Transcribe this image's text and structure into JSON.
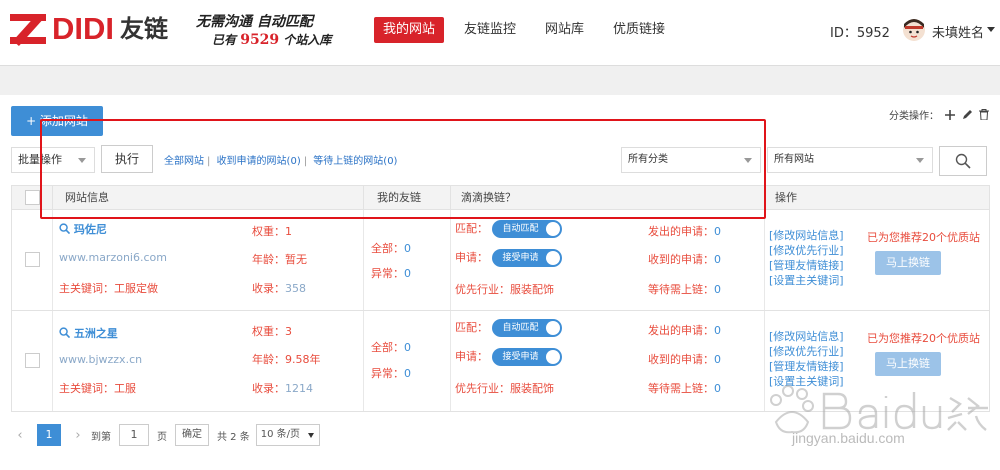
{
  "brand": {
    "logo_text": "DIDI",
    "logo_cn": "友链",
    "slogan_line1": "无需沟通 自动匹配",
    "slogan_prefix": "已有",
    "site_count": "9529",
    "slogan_suffix": "个站入库"
  },
  "nav": {
    "items": [
      "我的网站",
      "友链监控",
      "网站库",
      "优质链接"
    ],
    "active": 0
  },
  "user": {
    "id_label": "ID：5952",
    "name": "未填姓名"
  },
  "toolbar": {
    "add_site": "+ 添加网站",
    "category_ops": "分类操作：",
    "batch_ops": "批量操作",
    "execute": "执行",
    "filters": [
      "全部网站",
      "收到申请的网站(0)",
      "等待上链的网站(0)"
    ],
    "all_categories": "所有分类",
    "all_sites": "所有网站"
  },
  "table": {
    "headers": [
      "网站信息",
      "我的友链",
      "滴滴换链？",
      "操作"
    ],
    "rows": [
      {
        "name": "玛佐尼",
        "url": "www.marzoni6.com",
        "keyword_label": "主关键词：",
        "keyword": "工服定做",
        "weight_label": "权重：",
        "weight": "1",
        "age_label": "年龄：",
        "age": "暂无",
        "indexed_label": "收录：",
        "indexed": "358",
        "all_label": "全部：",
        "all": "0",
        "abnormal_label": "异常：",
        "abnormal": "0",
        "match_label": "匹配：",
        "match_toggle": "自动匹配",
        "apply_label": "申请：",
        "apply_toggle": "接受申请",
        "industry_label": "优先行业：",
        "industry": "服装配饰",
        "sent_label": "发出的申请：",
        "sent": "0",
        "received_label": "收到的申请：",
        "received": "0",
        "waiting_label": "等待需上链：",
        "waiting": "0",
        "ops": [
          "[修改网站信息]",
          "[修改优先行业]",
          "[管理友情链接]",
          "[设置主关键词]"
        ],
        "recommend": "已为您推荐20个优质站",
        "swap": "马上换链"
      },
      {
        "name": "五洲之星",
        "url": "www.bjwzzx.cn",
        "keyword_label": "主关键词：",
        "keyword": "工服",
        "weight_label": "权重：",
        "weight": "3",
        "age_label": "年龄：",
        "age": "9.58年",
        "indexed_label": "收录：",
        "indexed": "1214",
        "all_label": "全部：",
        "all": "0",
        "abnormal_label": "异常：",
        "abnormal": "0",
        "match_label": "匹配：",
        "match_toggle": "自动匹配",
        "apply_label": "申请：",
        "apply_toggle": "接受申请",
        "industry_label": "优先行业：",
        "industry": "服装配饰",
        "sent_label": "发出的申请：",
        "sent": "0",
        "received_label": "收到的申请：",
        "received": "0",
        "waiting_label": "等待需上链：",
        "waiting": "0",
        "ops": [
          "[修改网站信息]",
          "[修改优先行业]",
          "[管理友情链接]",
          "[设置主关键词]"
        ],
        "recommend": "已为您推荐20个优质站",
        "swap": "马上换链"
      }
    ]
  },
  "pager": {
    "current": "1",
    "goto": "到第",
    "input": "1",
    "page": "页",
    "confirm": "确定",
    "total": "共 2 条",
    "size": "10 条/页"
  },
  "watermark": {
    "text": "jingyan.baidu.com"
  },
  "colors": {
    "brand_red": "#d8232a",
    "primary_blue": "#3e8ed6",
    "highlight": "#e0141a"
  }
}
